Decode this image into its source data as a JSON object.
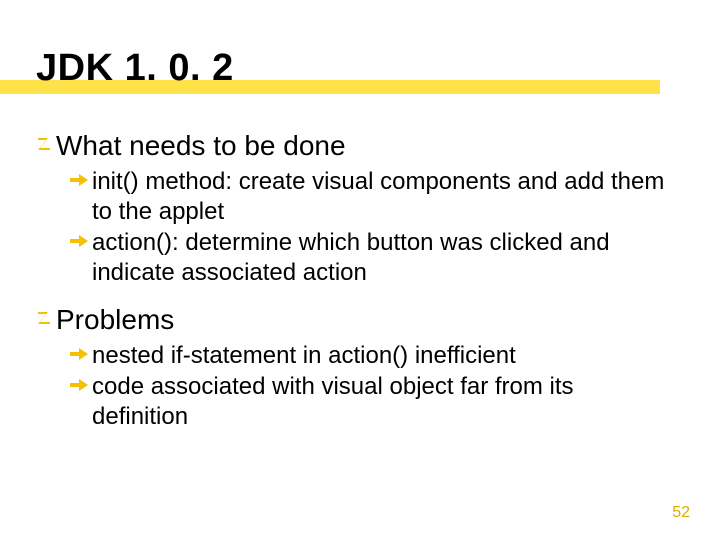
{
  "title": "JDK 1. 0. 2",
  "sections": [
    {
      "heading": "What needs to be done",
      "items": [
        "init() method: create visual components and add them to the applet",
        "action(): determine which button was clicked and indicate associated action"
      ]
    },
    {
      "heading": "Problems",
      "items": [
        "nested if-statement in action() inefficient",
        "code associated with visual object far from its definition"
      ]
    }
  ],
  "page_number": "52"
}
